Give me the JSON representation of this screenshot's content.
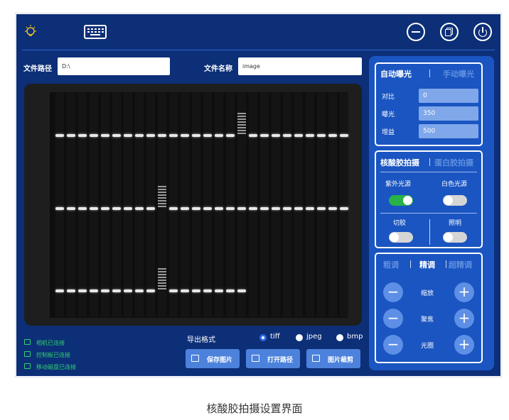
{
  "toolbar": {
    "icons": [
      "bulb-icon",
      "keyboard-icon",
      "minimize-icon",
      "restore-icon",
      "power-icon"
    ]
  },
  "file": {
    "path_label": "文件路径",
    "path_value": "D:\\",
    "name_label": "文件名称",
    "name_value": "image"
  },
  "exposure": {
    "auto_tab": "自动曝光",
    "manual_tab": "手动曝光",
    "contrast_label": "对比",
    "contrast_value": "0",
    "exposure_label": "曝光",
    "exposure_value": "350",
    "gain_label": "增益",
    "gain_value": "500"
  },
  "capture": {
    "nucleic_tab": "核酸胶拍摄",
    "protein_tab": "蛋白胶拍摄",
    "uv_label": "紫外光源",
    "uv_on": true,
    "white_label": "白色光源",
    "white_on": false,
    "cut_label": "切胶",
    "cut_on": false,
    "light_label": "照明",
    "light_on": false
  },
  "tuning": {
    "coarse_tab": "粗调",
    "fine_tab": "精调",
    "superfine_tab": "超精调",
    "zoom_label": "缩放",
    "focus_label": "聚焦",
    "aperture_label": "光圈",
    "minus": "−",
    "plus": "+"
  },
  "status": {
    "camera": "相机已连接",
    "board": "控制板已连接",
    "disk": "移动磁盘已连接"
  },
  "export": {
    "label": "导出格式",
    "options": [
      "tiff",
      "jpeg",
      "bmp"
    ],
    "selected": "tiff"
  },
  "actions": {
    "save": "保存图片",
    "open_path": "打开路径",
    "crop": "图片裁剪"
  },
  "caption": "核酸胶拍摄设置界面",
  "colors": {
    "background": "#0c2f78",
    "panel": "#1a55c1",
    "status_green": "#2fd06a",
    "toggle_on": "#27b24a"
  }
}
